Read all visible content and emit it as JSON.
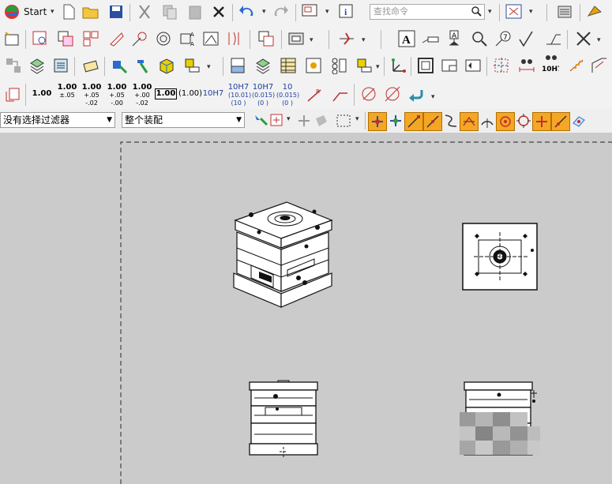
{
  "toolbar_row1": {
    "start_label": "Start",
    "search_placeholder": "查找命令"
  },
  "toolbar_row4": {
    "dimension_buttons": [
      {
        "main": "1.00",
        "sub": ""
      },
      {
        "main": "1.00",
        "sub": "±.05"
      },
      {
        "main": "1.00",
        "sub": "+.05 -.02"
      },
      {
        "main": "1.00",
        "sub": "+.05 -.00"
      },
      {
        "main": "1.00",
        "sub": "+.00 -.02"
      },
      {
        "main": "1.00",
        "sub": ""
      },
      {
        "main": "(1.00)",
        "sub": ""
      },
      {
        "main": "10H7",
        "sub": ""
      },
      {
        "main": "10H7",
        "sub": "(10.01) (10  )"
      },
      {
        "main": "10H7",
        "sub": "(0.015) (0  )"
      },
      {
        "main": "10",
        "sub": "(0.015) (0  )"
      }
    ]
  },
  "filter_bar": {
    "selection_filter": "没有选择过滤器",
    "assembly_scope": "整个装配"
  },
  "row3": {
    "view_label": "10H7"
  },
  "colors": {
    "toolbar_bg": "#f2f2f2",
    "canvas_bg": "#cbcbcb",
    "accent_orange": "#f5a623",
    "icon_blue": "#2a6bd1"
  }
}
